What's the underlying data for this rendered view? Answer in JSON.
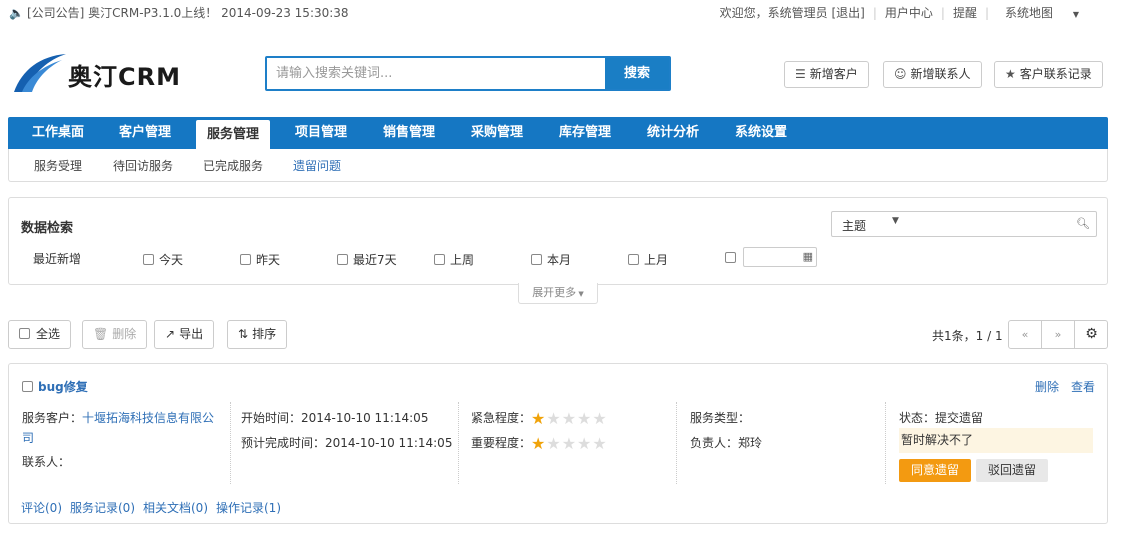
{
  "topbar": {
    "notice": "[公司公告] 奥汀CRM-P3.1.0上线！ 2014-09-23 15:30:38",
    "welcome": "欢迎您，系统管理员 [退出]",
    "user_center": "用户中心",
    "reminder": "提醒",
    "sitemap": "系统地图"
  },
  "brand": {
    "name": "奥汀CRM"
  },
  "search": {
    "placeholder": "请输入搜索关键词...",
    "button": "搜索"
  },
  "quick": {
    "add_customer": "新增客户",
    "add_contact": "新增联系人",
    "contact_log": "客户联系记录"
  },
  "nav": {
    "items": [
      "工作桌面",
      "客户管理",
      "服务管理",
      "项目管理",
      "销售管理",
      "采购管理",
      "库存管理",
      "统计分析",
      "系统设置"
    ],
    "active": "服务管理"
  },
  "subnav": {
    "items": [
      "服务受理",
      "待回访服务",
      "已完成服务",
      "遗留问题"
    ],
    "active": "遗留问题"
  },
  "filter": {
    "title": "数据检索",
    "field_select": "主题",
    "row_label": "最近新增",
    "options": [
      "今天",
      "昨天",
      "最近7天",
      "上周",
      "本月",
      "上月"
    ],
    "expand": "展开更多"
  },
  "toolbar": {
    "select_all": "全选",
    "delete": "删除",
    "export": "导出",
    "sort": "排序"
  },
  "pager": {
    "info": "共1条，1 / 1",
    "prev": "«",
    "next": "»"
  },
  "record": {
    "title": "bug修复",
    "actions": {
      "delete": "删除",
      "view": "查看"
    },
    "customer_label": "服务客户：",
    "customer_line1": "十堰拓海科技信息有限公",
    "customer_line2": "司",
    "contact_label": "联系人：",
    "start": "开始时间：2014-10-10 11:14:05",
    "due": "预计完成时间：2014-10-10 11:14:05",
    "urgency_label": "紧急程度：",
    "urgency_stars": 1,
    "importance_label": "重要程度：",
    "importance_stars": 1,
    "max_stars": 5,
    "service_type": "服务类型：",
    "owner": "负责人：郑玲",
    "status": "状态：提交遗留",
    "note": "暂时解决不了",
    "approve": "同意遗留",
    "reject": "驳回遗留",
    "links": [
      "评论(0)",
      "服务记录(0)",
      "相关文档(0)",
      "操作记录(1)"
    ]
  },
  "colors": {
    "primary": "#1577c3",
    "accent": "#f39a11",
    "link": "#2f6fb6",
    "star": "#f0a30a"
  }
}
